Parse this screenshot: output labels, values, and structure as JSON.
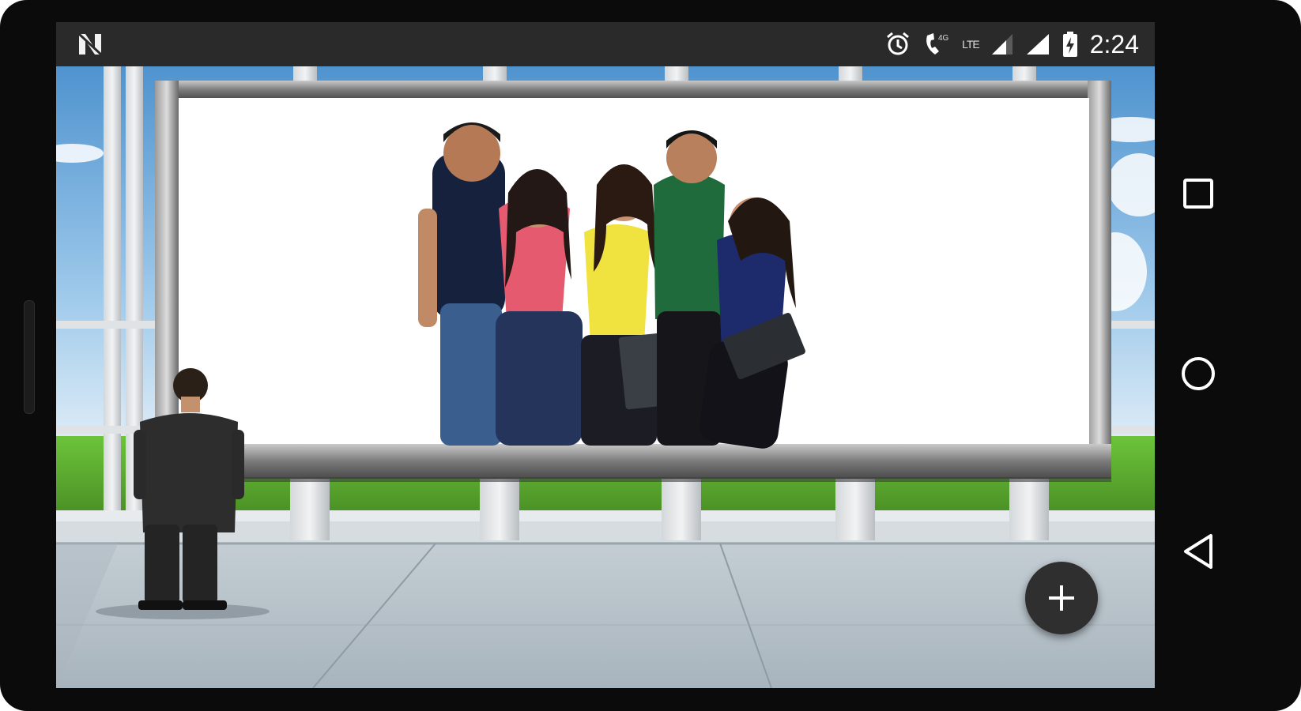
{
  "status_bar": {
    "time": "2:24",
    "network_label": "LTE",
    "icons": [
      "notification-n-icon",
      "alarm-icon",
      "wifi-calling-4g-icon",
      "lte-icon",
      "signal-icon",
      "signal-full-icon",
      "battery-charging-icon"
    ]
  },
  "navigation": {
    "icons": [
      "recent-apps-icon",
      "home-icon",
      "back-icon"
    ]
  },
  "fab": {
    "icon": "plus-icon"
  },
  "colors": {
    "status_bar_bg": "#2a2a2a",
    "device_bezel": "#0b0b0b",
    "fab_bg": "#2f2f2f",
    "sky": "#6aa6d8",
    "grass": "#5fa832",
    "floor": "#b9c4cc",
    "billboard_frame": "#8a8a8a"
  }
}
